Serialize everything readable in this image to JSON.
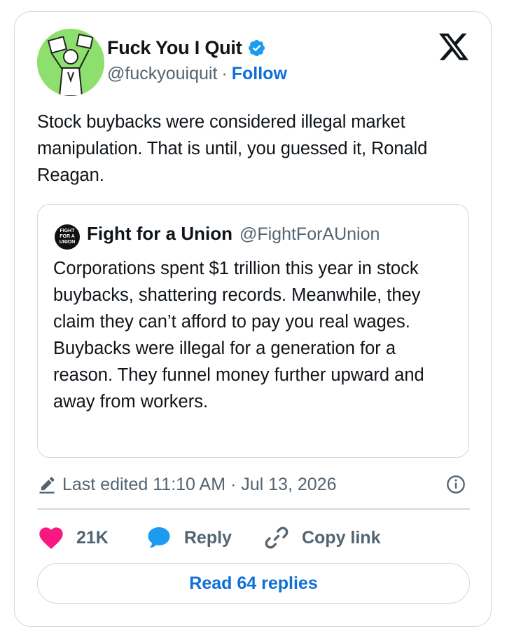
{
  "tweet": {
    "author_name": "Fuck You I Quit",
    "author_handle": "@fuckyouiquit",
    "separator": "·",
    "follow_label": "Follow",
    "text": "Stock buybacks were considered illegal market manipulation. That is until, you guessed it, Ronald Reagan.",
    "quote": {
      "avatar_lines": [
        "FIGHT",
        "FOR A",
        "UNION"
      ],
      "author_name": "Fight for a Union",
      "author_handle": "@FightForAUnion",
      "text": "Corporations spent $1 trillion this year in stock buybacks, shattering records. Meanwhile, they claim they can’t afford to pay you real wages. Buybacks were illegal for a generation for a reason. They funnel money further upward and away from workers."
    },
    "edited_meta": "Last edited 11:10 AM · Jul 13, 2026",
    "actions": {
      "likes": "21K",
      "reply_label": "Reply",
      "copy_link_label": "Copy link"
    },
    "read_replies_label": "Read 64 replies"
  },
  "colors": {
    "accent": "#0f6fd6",
    "like_heart": "#f91880",
    "reply_bubble": "#1d9bf0",
    "avatar_bg": "#8ee06e",
    "muted_text": "#536471",
    "border": "#cfd9de"
  },
  "icons": {
    "verified": "verified-badge-icon",
    "platform": "x-logo-icon",
    "edit": "pencil-icon",
    "info": "info-icon",
    "like": "heart-icon",
    "reply": "speech-bubble-icon",
    "copy_link": "link-icon"
  }
}
